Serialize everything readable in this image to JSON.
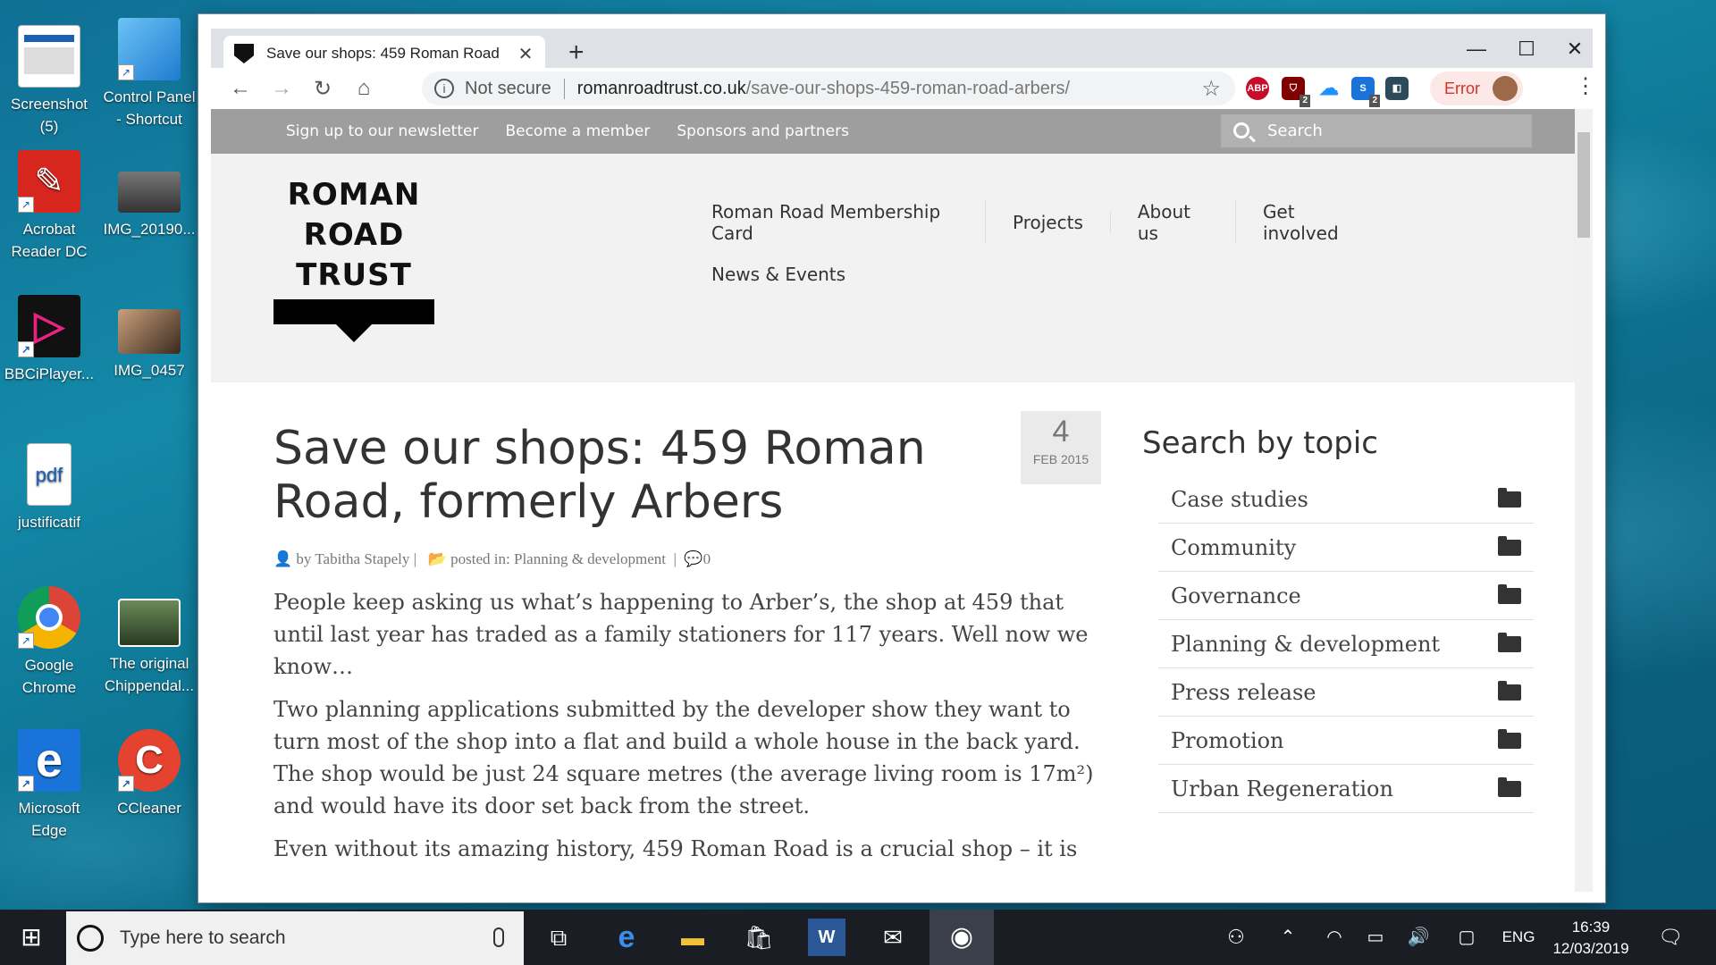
{
  "desktop": {
    "icons": [
      {
        "label": "Screenshot (5)"
      },
      {
        "label": "Control Panel - Shortcut"
      },
      {
        "label": "Acrobat Reader DC"
      },
      {
        "label": "IMG_20190..."
      },
      {
        "label": "BBCiPlayer..."
      },
      {
        "label": "IMG_0457"
      },
      {
        "label": "justificatif"
      },
      {
        "label": "Google Chrome"
      },
      {
        "label": "The original Chippendal..."
      },
      {
        "label": "Microsoft Edge"
      },
      {
        "label": "CCleaner"
      }
    ]
  },
  "browser": {
    "tab_title": "Save our shops: 459 Roman Road",
    "new_tab": "+",
    "not_secure": "Not secure",
    "url_host": "romanroadtrust.co.uk",
    "url_path": "/save-our-shops-459-roman-road-arbers/",
    "ext_abp": "ABP",
    "ext_badge1": "2",
    "ext_badge2": "2",
    "error_label": "Error"
  },
  "site": {
    "topnav": [
      "Sign up to our newsletter",
      "Become a member",
      "Sponsors and partners"
    ],
    "search_placeholder": "Search",
    "logo": [
      "ROMAN",
      "ROAD",
      "TRUST"
    ],
    "mainnav_row1": [
      "Roman Road Membership Card",
      "Projects",
      "About us",
      "Get involved"
    ],
    "mainnav_row2": [
      "News & Events"
    ],
    "article": {
      "title": "Save our shops: 459 Roman Road, formerly Arbers",
      "date_day": "4",
      "date_month": "FEB 2015",
      "meta_by": "by Tabitha Stapely |",
      "meta_posted": "posted in: Planning & development",
      "meta_sep": "|",
      "meta_comments": "0",
      "p1": "People keep asking us what’s happening to Arber’s, the shop at 459 that until last year has traded as a family stationers for 117 years. Well now we know…",
      "p2": "Two planning applications submitted by the developer show they want to turn most of the shop into a flat and build a whole house in the back yard. The shop would be just 24 square metres (the average living room is 17m²) and would have its door set back from the street.",
      "p3": "Even without its amazing history, 459 Roman Road is a crucial shop – it is"
    },
    "sidebar": {
      "heading": "Search by topic",
      "topics": [
        "Case studies",
        "Community",
        "Governance",
        "Planning & development",
        "Press release",
        "Promotion",
        "Urban Regeneration"
      ]
    }
  },
  "taskbar": {
    "search_placeholder": "Type here to search",
    "lang": "ENG",
    "time": "16:39",
    "date": "12/03/2019"
  }
}
